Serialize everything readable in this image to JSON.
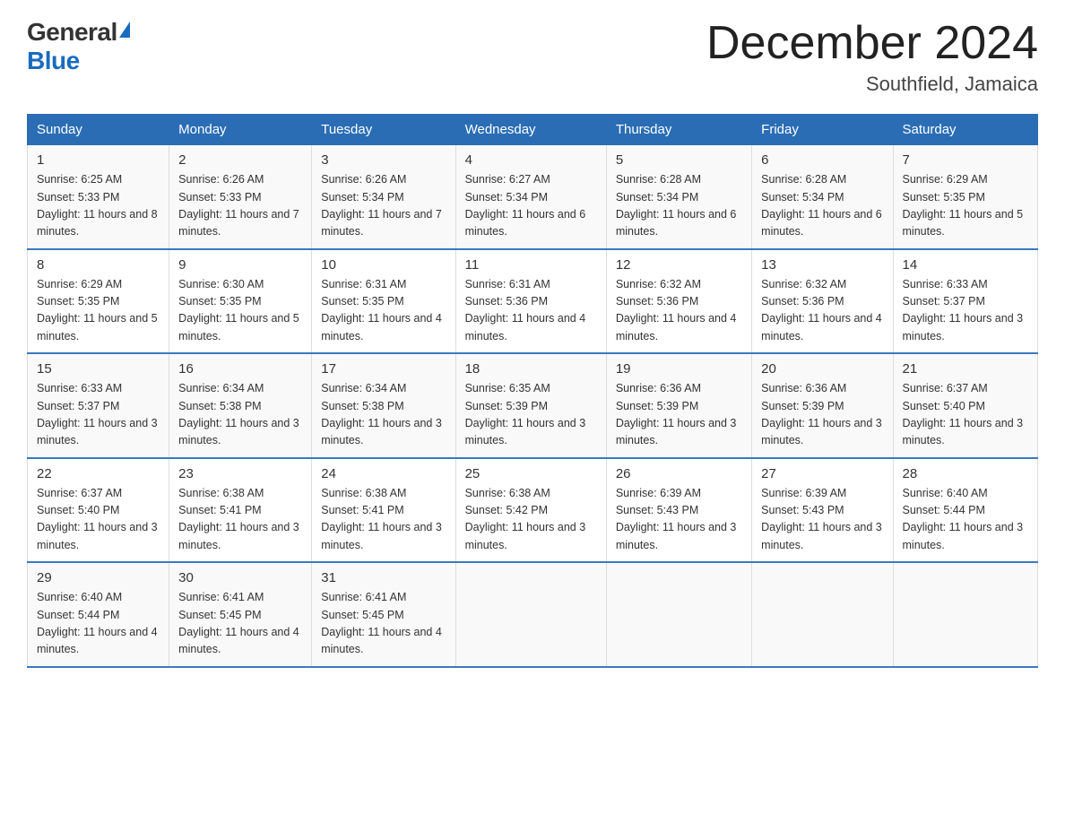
{
  "logo": {
    "general": "General",
    "blue": "Blue"
  },
  "title": "December 2024",
  "subtitle": "Southfield, Jamaica",
  "days_of_week": [
    "Sunday",
    "Monday",
    "Tuesday",
    "Wednesday",
    "Thursday",
    "Friday",
    "Saturday"
  ],
  "weeks": [
    [
      {
        "day": "1",
        "sunrise": "6:25 AM",
        "sunset": "5:33 PM",
        "daylight": "11 hours and 8 minutes."
      },
      {
        "day": "2",
        "sunrise": "6:26 AM",
        "sunset": "5:33 PM",
        "daylight": "11 hours and 7 minutes."
      },
      {
        "day": "3",
        "sunrise": "6:26 AM",
        "sunset": "5:34 PM",
        "daylight": "11 hours and 7 minutes."
      },
      {
        "day": "4",
        "sunrise": "6:27 AM",
        "sunset": "5:34 PM",
        "daylight": "11 hours and 6 minutes."
      },
      {
        "day": "5",
        "sunrise": "6:28 AM",
        "sunset": "5:34 PM",
        "daylight": "11 hours and 6 minutes."
      },
      {
        "day": "6",
        "sunrise": "6:28 AM",
        "sunset": "5:34 PM",
        "daylight": "11 hours and 6 minutes."
      },
      {
        "day": "7",
        "sunrise": "6:29 AM",
        "sunset": "5:35 PM",
        "daylight": "11 hours and 5 minutes."
      }
    ],
    [
      {
        "day": "8",
        "sunrise": "6:29 AM",
        "sunset": "5:35 PM",
        "daylight": "11 hours and 5 minutes."
      },
      {
        "day": "9",
        "sunrise": "6:30 AM",
        "sunset": "5:35 PM",
        "daylight": "11 hours and 5 minutes."
      },
      {
        "day": "10",
        "sunrise": "6:31 AM",
        "sunset": "5:35 PM",
        "daylight": "11 hours and 4 minutes."
      },
      {
        "day": "11",
        "sunrise": "6:31 AM",
        "sunset": "5:36 PM",
        "daylight": "11 hours and 4 minutes."
      },
      {
        "day": "12",
        "sunrise": "6:32 AM",
        "sunset": "5:36 PM",
        "daylight": "11 hours and 4 minutes."
      },
      {
        "day": "13",
        "sunrise": "6:32 AM",
        "sunset": "5:36 PM",
        "daylight": "11 hours and 4 minutes."
      },
      {
        "day": "14",
        "sunrise": "6:33 AM",
        "sunset": "5:37 PM",
        "daylight": "11 hours and 3 minutes."
      }
    ],
    [
      {
        "day": "15",
        "sunrise": "6:33 AM",
        "sunset": "5:37 PM",
        "daylight": "11 hours and 3 minutes."
      },
      {
        "day": "16",
        "sunrise": "6:34 AM",
        "sunset": "5:38 PM",
        "daylight": "11 hours and 3 minutes."
      },
      {
        "day": "17",
        "sunrise": "6:34 AM",
        "sunset": "5:38 PM",
        "daylight": "11 hours and 3 minutes."
      },
      {
        "day": "18",
        "sunrise": "6:35 AM",
        "sunset": "5:39 PM",
        "daylight": "11 hours and 3 minutes."
      },
      {
        "day": "19",
        "sunrise": "6:36 AM",
        "sunset": "5:39 PM",
        "daylight": "11 hours and 3 minutes."
      },
      {
        "day": "20",
        "sunrise": "6:36 AM",
        "sunset": "5:39 PM",
        "daylight": "11 hours and 3 minutes."
      },
      {
        "day": "21",
        "sunrise": "6:37 AM",
        "sunset": "5:40 PM",
        "daylight": "11 hours and 3 minutes."
      }
    ],
    [
      {
        "day": "22",
        "sunrise": "6:37 AM",
        "sunset": "5:40 PM",
        "daylight": "11 hours and 3 minutes."
      },
      {
        "day": "23",
        "sunrise": "6:38 AM",
        "sunset": "5:41 PM",
        "daylight": "11 hours and 3 minutes."
      },
      {
        "day": "24",
        "sunrise": "6:38 AM",
        "sunset": "5:41 PM",
        "daylight": "11 hours and 3 minutes."
      },
      {
        "day": "25",
        "sunrise": "6:38 AM",
        "sunset": "5:42 PM",
        "daylight": "11 hours and 3 minutes."
      },
      {
        "day": "26",
        "sunrise": "6:39 AM",
        "sunset": "5:43 PM",
        "daylight": "11 hours and 3 minutes."
      },
      {
        "day": "27",
        "sunrise": "6:39 AM",
        "sunset": "5:43 PM",
        "daylight": "11 hours and 3 minutes."
      },
      {
        "day": "28",
        "sunrise": "6:40 AM",
        "sunset": "5:44 PM",
        "daylight": "11 hours and 3 minutes."
      }
    ],
    [
      {
        "day": "29",
        "sunrise": "6:40 AM",
        "sunset": "5:44 PM",
        "daylight": "11 hours and 4 minutes."
      },
      {
        "day": "30",
        "sunrise": "6:41 AM",
        "sunset": "5:45 PM",
        "daylight": "11 hours and 4 minutes."
      },
      {
        "day": "31",
        "sunrise": "6:41 AM",
        "sunset": "5:45 PM",
        "daylight": "11 hours and 4 minutes."
      },
      null,
      null,
      null,
      null
    ]
  ]
}
